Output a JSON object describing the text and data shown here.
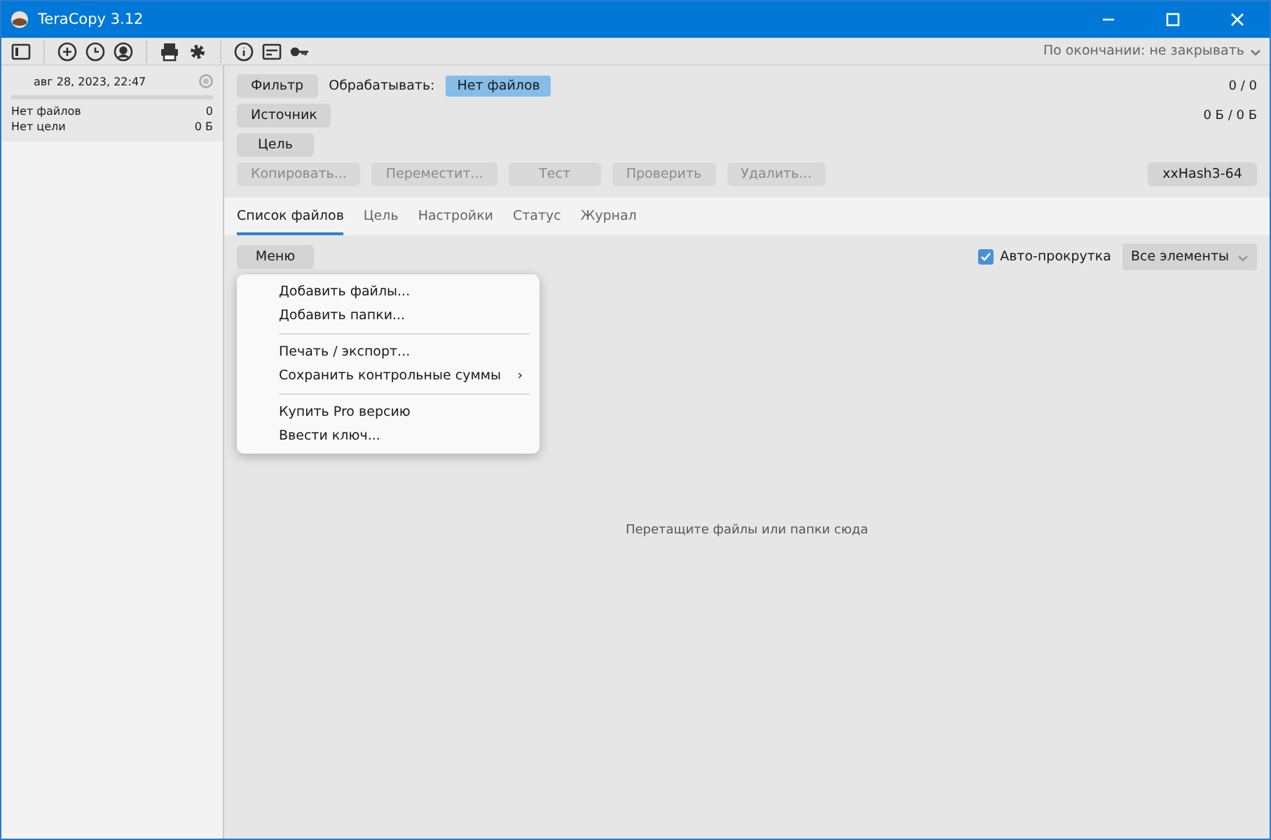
{
  "window": {
    "title": "TeraCopy 3.12"
  },
  "toolbar": {
    "on_finish": "По окончании: не закрывать"
  },
  "sidebar": {
    "items": [
      {
        "date": "авг 28, 2023, 22:47",
        "level": 0,
        "rows": [
          {
            "label": "Нет файлов",
            "value": "0"
          },
          {
            "label": "Нет цели",
            "value": "0 Б"
          }
        ]
      }
    ]
  },
  "panel": {
    "filter": "Фильтр",
    "process_label": "Обрабатывать:",
    "process_value": "Нет файлов",
    "source": "Источник",
    "target": "Цель",
    "count": "0 / 0",
    "size": "0 Б / 0 Б",
    "actions": [
      {
        "label": "Копировать...",
        "disabled": true
      },
      {
        "label": "Переместит...",
        "disabled": true
      },
      {
        "label": "Тест",
        "disabled": true
      },
      {
        "label": "Проверить",
        "disabled": true
      },
      {
        "label": "Удалить...",
        "disabled": true
      }
    ],
    "hash": "xxHash3-64"
  },
  "tabs": [
    {
      "label": "Список файлов",
      "selected": true
    },
    {
      "label": "Цель",
      "selected": false
    },
    {
      "label": "Настройки",
      "selected": false
    },
    {
      "label": "Статус",
      "selected": false
    },
    {
      "label": "Журнал",
      "selected": false
    }
  ],
  "file_list": {
    "menu_button": "Меню",
    "auto_scroll": {
      "label": "Авто-прокрутка",
      "checked": true
    },
    "view": "Все элементы",
    "empty_text": "Перетащите файлы или папки сюда"
  },
  "menu": {
    "items": [
      {
        "kind": "item",
        "label": "Добавить файлы..."
      },
      {
        "kind": "item",
        "label": "Добавить папки..."
      },
      {
        "kind": "separator"
      },
      {
        "kind": "item",
        "label": "Печать / экспорт..."
      },
      {
        "kind": "submenu",
        "label": "Сохранить контрольные суммы",
        "arrow": "›"
      },
      {
        "kind": "separator"
      },
      {
        "kind": "item",
        "label": "Купить Pro версию"
      },
      {
        "kind": "item",
        "label": "Ввести ключ..."
      }
    ]
  }
}
